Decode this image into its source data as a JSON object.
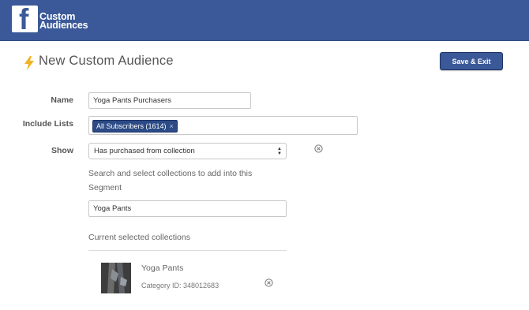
{
  "header": {
    "logo_letter": "f",
    "logo_line1": "Custom",
    "logo_line2": "Audiences"
  },
  "page": {
    "title": "New Custom Audience",
    "save_label": "Save & Exit"
  },
  "form": {
    "name_label": "Name",
    "name_value": "Yoga Pants Purchasers",
    "lists_label": "Include Lists",
    "list_chip": "All Subscribers (1614)",
    "chip_remove": "×",
    "show_label": "Show",
    "show_value": "Has purchased from collection",
    "search_hint": "Search and select collections to add into this Segment",
    "search_value": "Yoga Pants"
  },
  "collections": {
    "section_label": "Current selected collections",
    "items": [
      {
        "name": "Yoga Pants",
        "category_id": "Category ID: 348012683"
      }
    ]
  },
  "colors": {
    "brand": "#3b5998",
    "chip": "#2b4a86",
    "accent_bolt": "#f0b323"
  },
  "icons": [
    "facebook-logo",
    "lightning-bolt-icon",
    "select-arrows-icon",
    "remove-circle-icon",
    "collection-thumbnail"
  ]
}
